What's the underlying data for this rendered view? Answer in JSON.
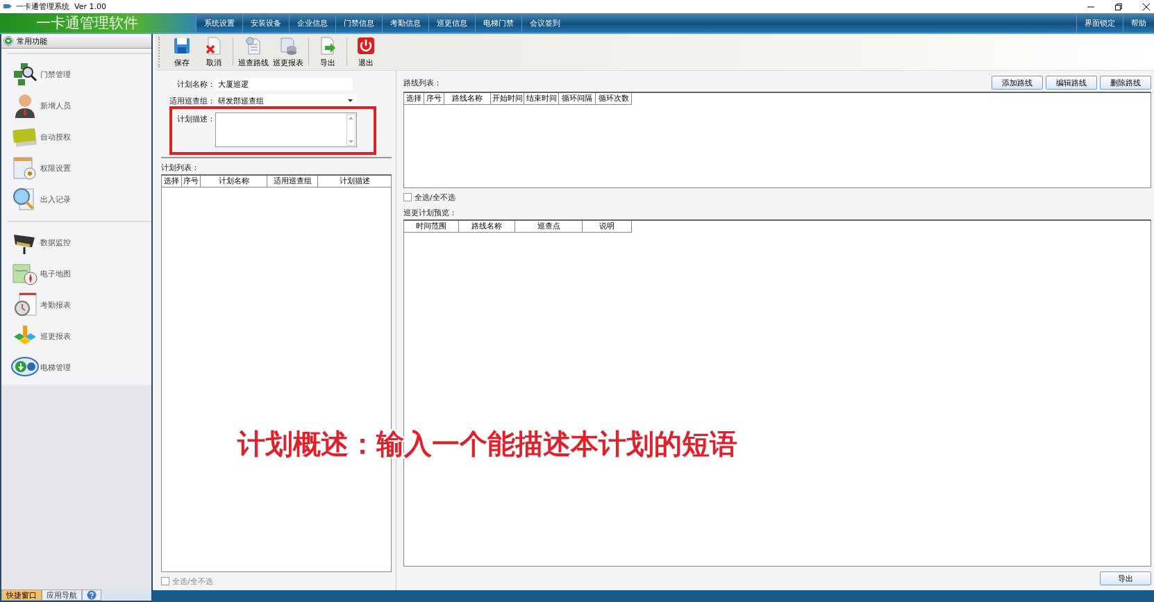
{
  "window": {
    "title": "一卡通管理系统  Ver 1.00"
  },
  "header": {
    "logo": "一卡通管理软件",
    "menu": [
      "系统设置",
      "安装设备",
      "企业信息",
      "门禁信息",
      "考勤信息",
      "巡更信息",
      "电梯门禁",
      "会议签到"
    ],
    "right_menu": [
      "界面锁定",
      "帮助"
    ]
  },
  "sidebar": {
    "title": "常用功能",
    "groups": [
      [
        "门禁管理",
        "新增人员",
        "自动授权",
        "权限设置",
        "出入记录"
      ],
      [
        "数据监控",
        "电子地图",
        "考勤报表",
        "巡更报表",
        "电梯管理"
      ]
    ],
    "tabs": [
      {
        "label": "快捷窗口",
        "selected": true
      },
      {
        "label": "应用导航",
        "selected": false
      }
    ]
  },
  "toolbar": {
    "groups": [
      [
        "保存",
        "取消"
      ],
      [
        "巡查路线",
        "巡更报表"
      ],
      [
        "导出"
      ],
      [
        "退出"
      ]
    ]
  },
  "plan_form": {
    "name_label": "计划名称：",
    "name_value": "大厦巡逻",
    "group_label": "适用巡查组：",
    "group_value": "研发部巡查组",
    "description_label": "计划描述：",
    "description_highlighted": true
  },
  "plan_list": {
    "label": "计划列表：",
    "columns": [
      "选择",
      "序号",
      "计划名称",
      "适用巡查组",
      "计划描述"
    ],
    "select_all": {
      "label": "全选/全不选",
      "checked": false
    }
  },
  "route_list": {
    "label": "路线列表：",
    "buttons": [
      "添加路线",
      "编辑路线",
      "删除路线"
    ],
    "columns": [
      "选择",
      "序号",
      "路线名称",
      "开始时间",
      "结束时间",
      "循环间隔",
      "循环次数"
    ],
    "select_all": {
      "label": "全选/全不选",
      "checked": false
    }
  },
  "preview": {
    "label": "巡更计划预览：",
    "columns": [
      "时间范围",
      "路线名称",
      "巡查点",
      "说明"
    ],
    "export_button": "导出"
  },
  "caption": "计划概述：输入一个能描述本计划的短语"
}
